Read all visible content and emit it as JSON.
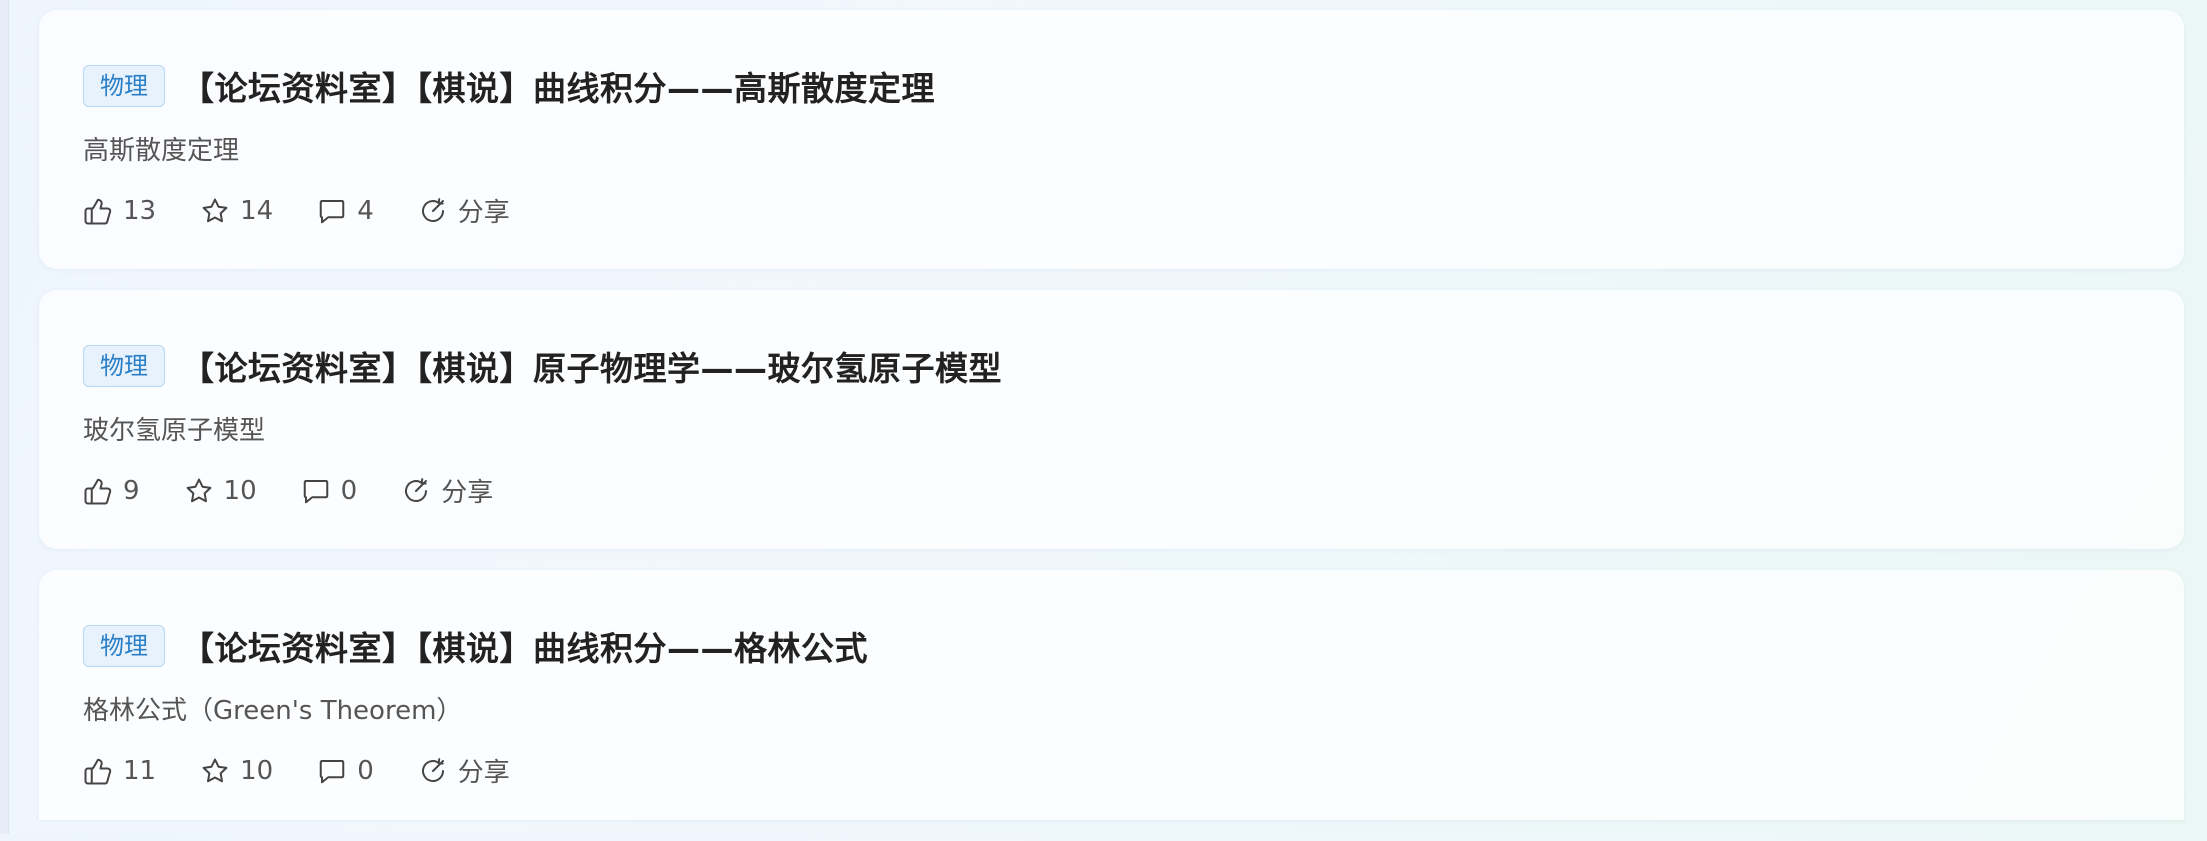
{
  "posts": [
    {
      "tag": "物理",
      "title": "【论坛资料室】【棋说】曲线积分——高斯散度定理",
      "summary": "高斯散度定理",
      "likes": "13",
      "favorites": "14",
      "comments": "4",
      "share_label": "分享"
    },
    {
      "tag": "物理",
      "title": "【论坛资料室】【棋说】原子物理学——玻尔氢原子模型",
      "summary": "玻尔氢原子模型",
      "likes": "9",
      "favorites": "10",
      "comments": "0",
      "share_label": "分享"
    },
    {
      "tag": "物理",
      "title": "【论坛资料室】【棋说】曲线积分——格林公式",
      "summary": "格林公式（Green's Theorem）",
      "likes": "11",
      "favorites": "10",
      "comments": "0",
      "share_label": "分享"
    }
  ],
  "icons": {
    "like": "thumbs-up-icon",
    "favorite": "star-icon",
    "comment": "comment-icon",
    "share": "share-icon"
  },
  "colors": {
    "tag_text": "#2b7fc7",
    "tag_bg": "#e7f2fc",
    "tag_border": "#b7d8f3"
  }
}
